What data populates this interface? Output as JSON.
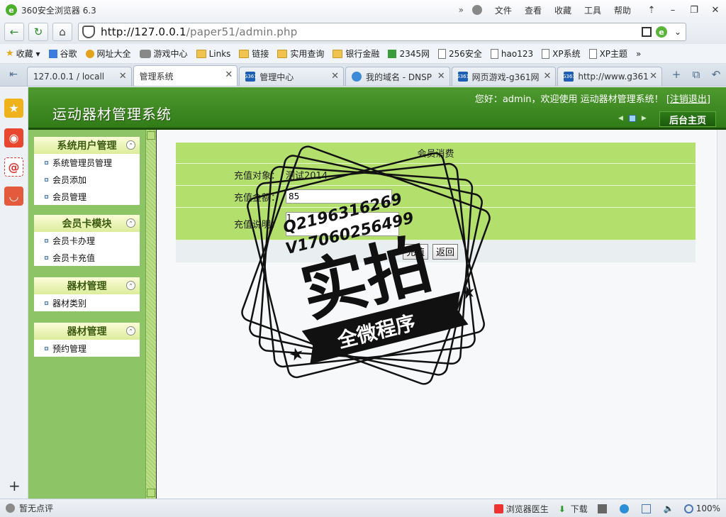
{
  "browser": {
    "title": "360安全浏览器 6.3",
    "menu": [
      "文件",
      "查看",
      "收藏",
      "工具",
      "帮助"
    ],
    "url_host": "http://127.0.0.1",
    "url_path": "/paper51/admin.php",
    "bookmarks": [
      "收藏",
      "谷歌",
      "网址大全",
      "游戏中心",
      "Links",
      "链接",
      "实用查询",
      "银行金融",
      "2345网",
      "256安全",
      "hao123",
      "XP系统",
      "XP主题"
    ],
    "tabs": [
      {
        "label": "127.0.0.1 / locall",
        "icon": "page"
      },
      {
        "label": "管理系统",
        "icon": "page"
      },
      {
        "label": "管理中心",
        "icon": "g361"
      },
      {
        "label": "我的域名 - DNSP",
        "icon": "globe"
      },
      {
        "label": "网页游戏-g361网",
        "icon": "g361"
      },
      {
        "label": "http://www.g361",
        "icon": "g361"
      }
    ],
    "status_left": "暂无点评",
    "status_doctor": "浏览器医生",
    "status_download": "下载",
    "zoom": "100%"
  },
  "header": {
    "system_title": "运动器材管理系统",
    "welcome": "您好：admin，欢迎使用 运动器材管理系统！",
    "logout": "注销退出",
    "home_button": "后台主页"
  },
  "menu": [
    {
      "title": "系统用户管理",
      "items": [
        "系统管理员管理",
        "会员添加",
        "会员管理"
      ]
    },
    {
      "title": "会员卡模块",
      "items": [
        "会员卡办理",
        "会员卡充值"
      ]
    },
    {
      "title": "器材管理",
      "items": [
        "器材类别"
      ]
    },
    {
      "title": "器材管理",
      "items": [
        "预约管理"
      ]
    }
  ],
  "form": {
    "title": "会员消费",
    "target_label": "充值对象：",
    "target_value": "测试2014",
    "amount_label": "充值金额：",
    "amount_value": "85",
    "note_label": "充值说明：",
    "note_value": "1",
    "submit_label": "充值",
    "back_label": "返回"
  },
  "watermark": {
    "contact_q": "Q2196316269",
    "contact_v": "V17060256499",
    "big_text": "实拍",
    "banner": "全微程序"
  }
}
